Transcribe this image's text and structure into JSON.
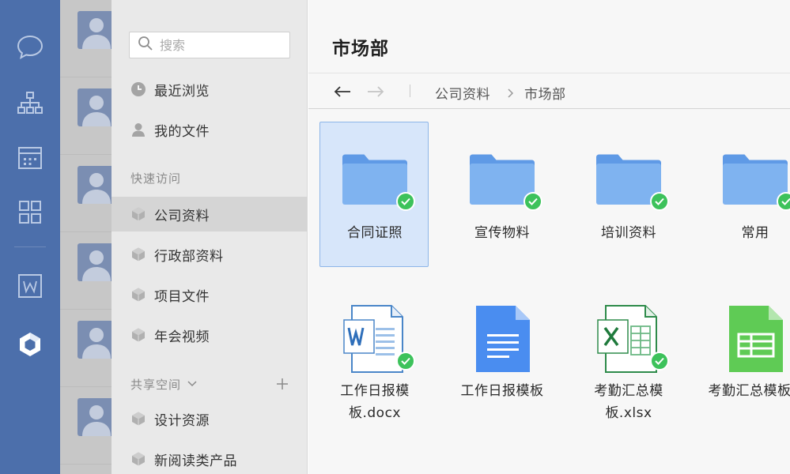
{
  "colors": {
    "rail_bg": "#4c6fab",
    "accent": "#4a90e2",
    "selected_tile_bg": "#d7e6fa",
    "sync_badge": "#3dc25b",
    "folder": "#7fb3f0"
  },
  "rail": {
    "icons": [
      "chat-bubble-icon",
      "org-chart-icon",
      "calendar-icon",
      "apps-grid-icon",
      "word-doc-icon",
      "cloud-drive-logo-icon"
    ]
  },
  "sidebar": {
    "search": {
      "placeholder": "搜索",
      "value": ""
    },
    "top_items": [
      {
        "label": "最近浏览",
        "icon": "clock-icon"
      },
      {
        "label": "我的文件",
        "icon": "user-icon"
      }
    ],
    "quick_access": {
      "title": "快速访问",
      "items": [
        {
          "label": "公司资料",
          "icon": "cube-icon",
          "active": true
        },
        {
          "label": "行政部资料",
          "icon": "cube-icon"
        },
        {
          "label": "项目文件",
          "icon": "cube-icon"
        },
        {
          "label": "年会视频",
          "icon": "cube-icon"
        }
      ]
    },
    "shared_space": {
      "title": "共享空间",
      "items": [
        {
          "label": "设计资源",
          "icon": "cube-icon"
        },
        {
          "label": "新阅读类产品",
          "icon": "cube-icon"
        }
      ]
    }
  },
  "main": {
    "title": "市场部",
    "breadcrumb": [
      "公司资料",
      "市场部"
    ],
    "folders": [
      {
        "name": "合同证照",
        "synced": true,
        "selected": true
      },
      {
        "name": "宣传物料",
        "synced": true
      },
      {
        "name": "培训资料",
        "synced": true
      },
      {
        "name": "常用",
        "synced": true
      }
    ],
    "files": [
      {
        "name_line1": "工作日报模",
        "name_line2": "板.docx",
        "type": "word-doc",
        "synced": true
      },
      {
        "name_line1": "工作日报模板",
        "name_line2": "",
        "type": "google-doc",
        "synced": false
      },
      {
        "name_line1": "考勤汇总模",
        "name_line2": "板.xlsx",
        "type": "excel-sheet",
        "synced": true
      },
      {
        "name_line1": "考勤汇总模板",
        "name_line2": "",
        "type": "google-sheet",
        "synced": false
      }
    ]
  }
}
